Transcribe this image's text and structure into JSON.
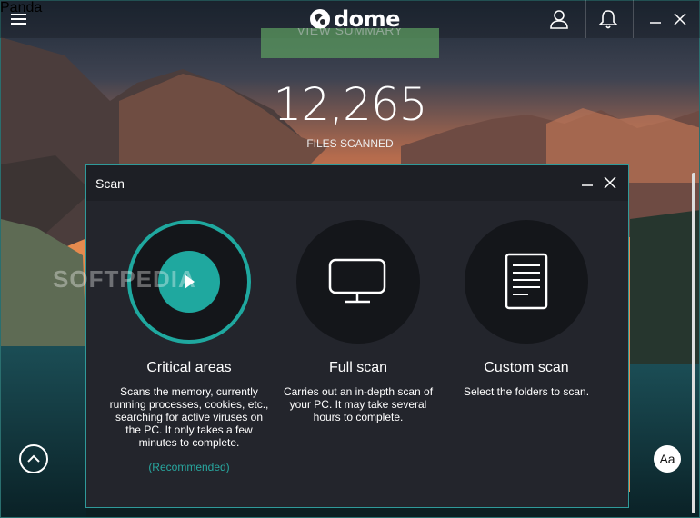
{
  "app": {
    "brand": "dome",
    "brand_small": "Panda"
  },
  "toolbar": {
    "menu_icon": "hamburger-icon",
    "user_icon": "user-icon",
    "bell_icon": "bell-icon"
  },
  "summary": {
    "button_label": "VIEW SUMMARY",
    "files_count": "12,265",
    "files_label": "FILES SCANNED"
  },
  "dialog": {
    "title": "Scan",
    "options": [
      {
        "title": "Critical areas",
        "description": "Scans the memory, currently running processes, cookies, etc., searching for active viruses on the PC. It only takes a few minutes to complete.",
        "note": "(Recommended)",
        "icon": "play-icon"
      },
      {
        "title": "Full scan",
        "description": "Carries out an in-depth scan of your PC. It may take several hours to complete.",
        "icon": "monitor-icon"
      },
      {
        "title": "Custom scan",
        "description": "Select the folders to scan.",
        "icon": "document-icon"
      }
    ]
  },
  "footer": {
    "font_button": "Aa"
  },
  "watermark": "SOFTPEDIA",
  "colors": {
    "accent": "#1fa89f",
    "dialog_bg": "#23252c",
    "dialog_border": "#2f9a9a"
  }
}
